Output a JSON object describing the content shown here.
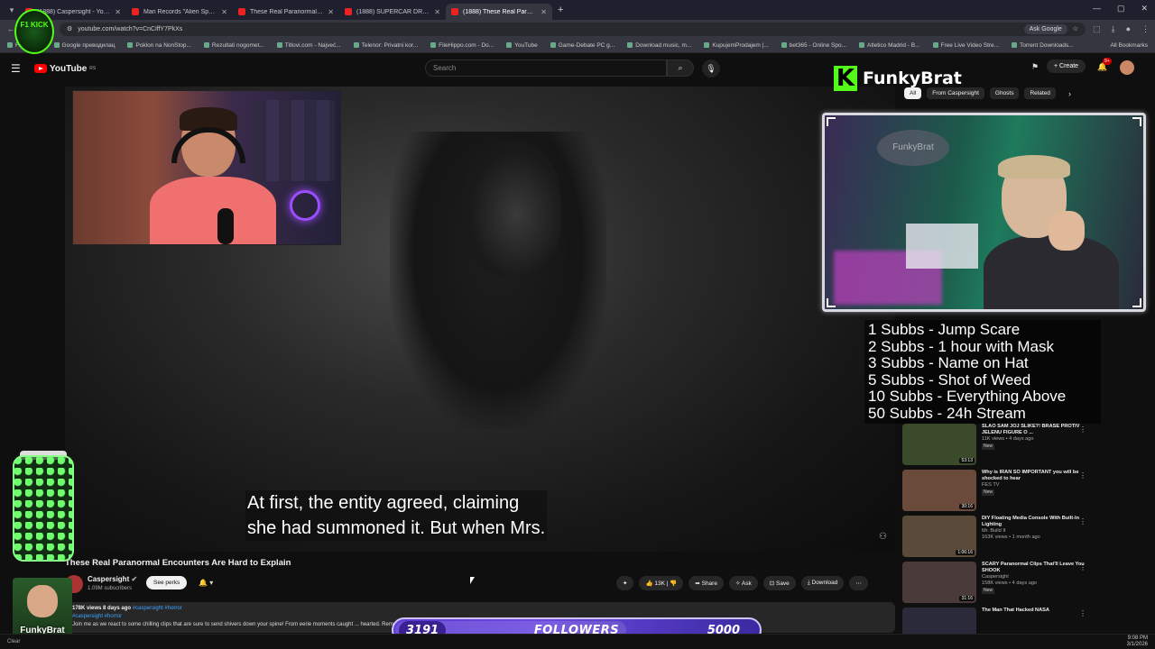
{
  "browser": {
    "tabs": [
      {
        "title": "(1888) Caspersight - YouTube",
        "active": false
      },
      {
        "title": "Man Records \"Alien Sphere\" Le",
        "active": false
      },
      {
        "title": "These Real Paranormal Encoun",
        "active": false
      },
      {
        "title": "(1888) SUPERCAR DRIVER PAR",
        "active": false
      },
      {
        "title": "(1888) These Real Paranorm",
        "active": true
      }
    ],
    "url": "youtube.com/watch?v=CnCiffY7PkXs",
    "ask_google": "Ask Google",
    "bookmarks": [
      "Facebook",
      "Google преводилац",
      "Poklon na NonStop...",
      "Rezultati nogomet...",
      "Titlovi.com - Najveć...",
      "Telenor: Privatni kor...",
      "FileHippo.com - Do...",
      "YouTube",
      "Game-Debate PC g...",
      "Download music, m...",
      "KupujemProdajem |...",
      "bet365 - Online Spo...",
      "Atletico Madrid - B...",
      "Free Live Video Stre...",
      "Torrent Downloads..."
    ],
    "all_bookmarks": "All Bookmarks"
  },
  "youtube": {
    "logo_text": "YouTube",
    "logo_sup": "RS",
    "search_placeholder": "Search",
    "create_label": "Create",
    "notif_count": "9+",
    "filter_chips": [
      {
        "label": "All",
        "active": true
      },
      {
        "label": "From Caspersight",
        "active": false
      },
      {
        "label": "Ghosts",
        "active": false
      },
      {
        "label": "Related",
        "active": false
      }
    ]
  },
  "video": {
    "caption_line1": "At first, the entity agreed, claiming",
    "caption_line2": "she had summoned it. But when Mrs.",
    "title": "These Real Paranormal Encounters Are Hard to Explain",
    "channel": "Caspersight",
    "subscribers": "1.09M subscribers",
    "perks_label": "See perks",
    "likes": "13K",
    "share": "Share",
    "ask": "Ask",
    "save": "Save",
    "download": "Download",
    "desc_stats": "178K views  8 days ago",
    "desc_tags_top": "#caspersight #horror",
    "desc_tags": "#caspersight #horror",
    "desc_text": "Join me as we react to some chilling clips that are sure to send shivers down your spine! From eerie moments caught ... hearted. Remember, don't watch al... know what you think below! 👇"
  },
  "stream": {
    "brand": "FunkyBrat",
    "cam_sign": "FunkyBrat",
    "kick_badge": "F1 KICK",
    "subs_goals": [
      "1 Subbs - Jump Scare",
      "2 Subbs - 1 hour with Mask",
      "3 Subbs - Name on Hat",
      "5 Subbs - Shot of Weed",
      "10 Subbs - Everything Above",
      "50 Subbs - 24h Stream"
    ],
    "followers_current": "3191",
    "followers_label": "FOLLOWERS",
    "followers_goal": "5000",
    "followers_progress": 0.638,
    "avatar_name": "FunkyBrat"
  },
  "recommendations": [
    {
      "title": "SLAO SAM JOJ SLIKE?! BRASE PROTIV JELENU FIGURE O ...",
      "channel": "",
      "meta": "11K views • 4 days ago",
      "duration": "53:13",
      "badge": "New",
      "color": "#3a4a2a"
    },
    {
      "title": "Why is IRAN SO IMPORTANT you will be shocked to hear",
      "channel": "FES TV",
      "meta": "",
      "duration": "30:16",
      "badge": "New",
      "color": "#6a4a3a"
    },
    {
      "title": "DIY Floating Media Console With Built-In Lighting",
      "channel": "Mr. Build It",
      "meta": "163K views • 1 month ago",
      "duration": "1:06:16",
      "badge": "",
      "color": "#5a4a3a"
    },
    {
      "title": "SCARY Paranormal Clips That'll Leave You SHOOK",
      "channel": "Caspersight",
      "meta": "158K views • 4 days ago",
      "duration": "31:16",
      "badge": "New",
      "color": "#4a3a3a"
    },
    {
      "title": "The Man That Hacked NASA",
      "channel": "",
      "meta": "",
      "duration": "",
      "badge": "",
      "color": "#2a2a3a"
    }
  ],
  "taskbar": {
    "weather": "Clear",
    "time": "9:08 PM",
    "date": "3/1/2026"
  }
}
